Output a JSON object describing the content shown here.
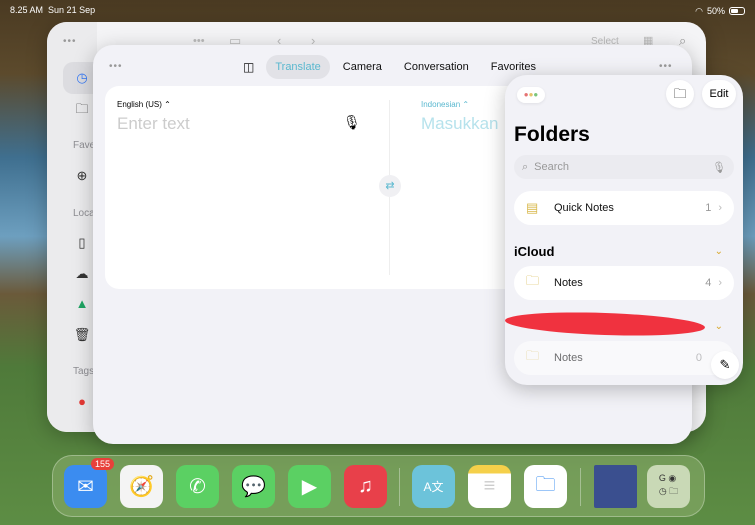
{
  "status": {
    "time": "8.25 AM",
    "date": "Sun 21 Sep",
    "battery": "50%",
    "battery_level": 0.5
  },
  "files": {
    "toolbar": {
      "select": "Select"
    },
    "sections": {
      "favorites": "Fave",
      "locations": "Loca",
      "tags": "Tags"
    }
  },
  "translate": {
    "tabs": [
      "Translate",
      "Camera",
      "Conversation",
      "Favorites"
    ],
    "active_tab": "Translate",
    "source": {
      "language": "English (US) ⌃",
      "placeholder": "Enter text"
    },
    "target": {
      "language": "Indonesian ⌃",
      "placeholder": "Masukkan"
    }
  },
  "notes": {
    "title": "Folders",
    "edit": "Edit",
    "search_placeholder": "Search",
    "quick_notes": {
      "label": "Quick Notes",
      "count": "1"
    },
    "icloud": {
      "label": "iCloud",
      "folder": "Notes",
      "count": "4"
    },
    "other": {
      "folder": "Notes",
      "count": "0"
    }
  },
  "dock": {
    "mail_badge": "155",
    "apps": [
      "Mail",
      "Safari",
      "Phone",
      "Messages",
      "FaceTime",
      "Music",
      "Translate",
      "Notes",
      "Files"
    ]
  },
  "colors": {
    "accent": "#5ab8cf",
    "folder": "#d8b84b",
    "badge": "#e8403a"
  }
}
